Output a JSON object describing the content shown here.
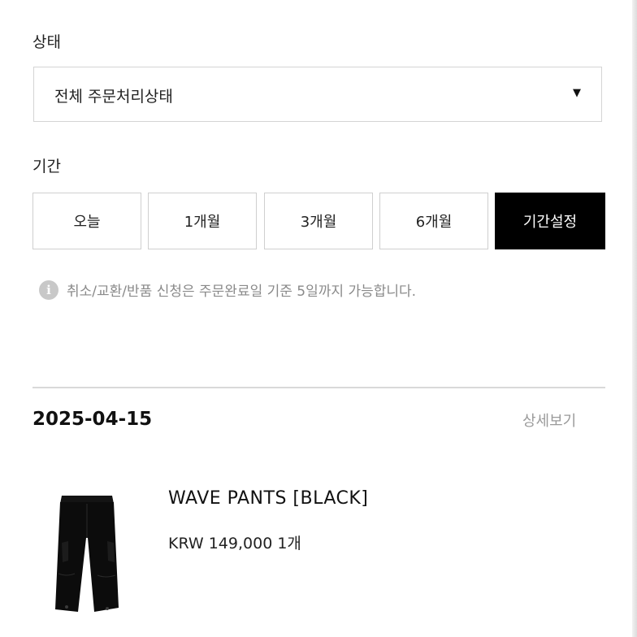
{
  "filters": {
    "status_label": "상태",
    "status_select": {
      "value": "전체 주문처리상태",
      "caret": "▼"
    },
    "period_label": "기간",
    "period_buttons": [
      {
        "label": "오늘",
        "active": false
      },
      {
        "label": "1개월",
        "active": false
      },
      {
        "label": "3개월",
        "active": false
      },
      {
        "label": "6개월",
        "active": false
      },
      {
        "label": "기간설정",
        "active": true
      }
    ],
    "notice": {
      "icon": "info-icon",
      "icon_glyph": "i",
      "text": "취소/교환/반품 신청은 주문완료일 기준 5일까지 가능합니다."
    }
  },
  "order": {
    "date": "2025-04-15",
    "detail_link": "상세보기",
    "item": {
      "name": "WAVE PANTS [BLACK]",
      "price": "KRW 149,000 1개"
    }
  },
  "colors": {
    "active_bg": "#000000",
    "border": "#cfcfcf",
    "muted_text": "#8a8a8a"
  }
}
